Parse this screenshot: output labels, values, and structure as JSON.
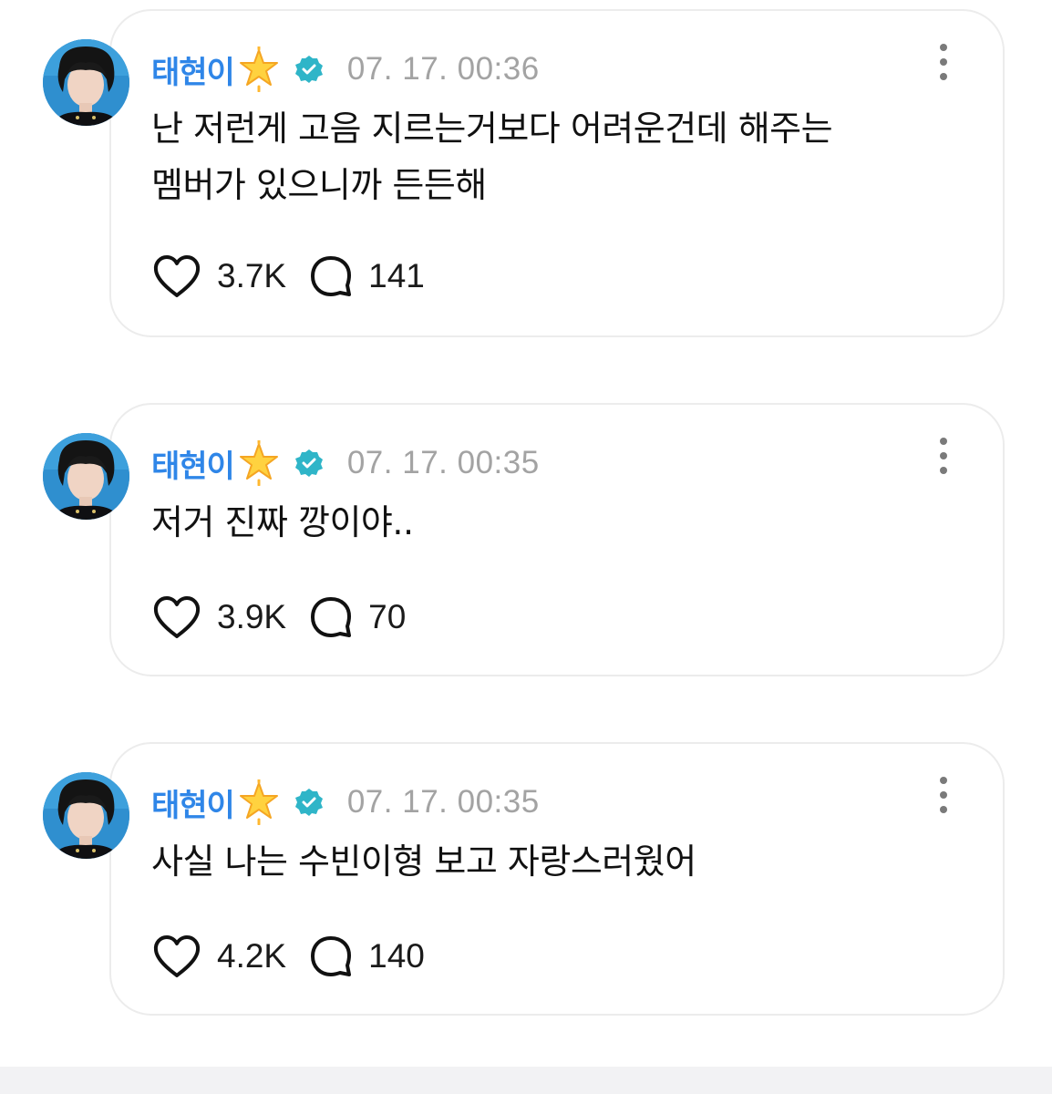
{
  "colors": {
    "username": "#2f86e8",
    "timestamp": "#a3a3a3",
    "verified_badge": "#2fb5c8",
    "card_border": "#ececec",
    "bottom_bar": "#f2f2f4"
  },
  "icons": {
    "star": "glowing-star-icon",
    "verified": "verified-badge-icon",
    "more": "more-vertical-icon",
    "like": "heart-icon",
    "reply": "speech-bubble-icon"
  },
  "posts": [
    {
      "username": "태현이",
      "timestamp": "07. 17. 00:36",
      "text": "난 저런게 고음 지르는거보다 어려운건데 해주는\n멤버가 있으니까 든든해",
      "likes": "3.7K",
      "replies": "141"
    },
    {
      "username": "태현이",
      "timestamp": "07. 17. 00:35",
      "text": "저거 진짜 깡이야..",
      "likes": "3.9K",
      "replies": "70"
    },
    {
      "username": "태현이",
      "timestamp": "07. 17. 00:35",
      "text": "사실 나는 수빈이형 보고 자랑스러웠어",
      "likes": "4.2K",
      "replies": "140"
    }
  ]
}
